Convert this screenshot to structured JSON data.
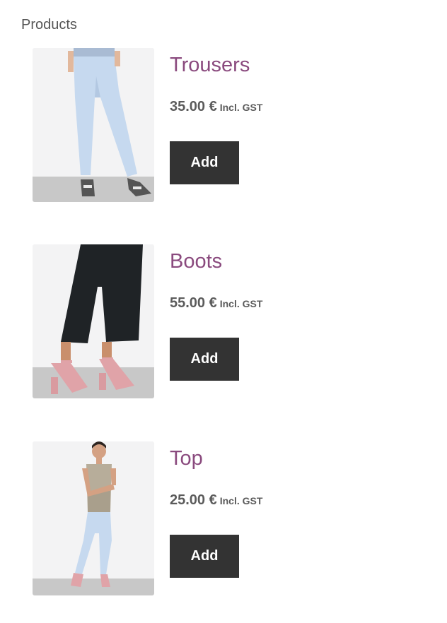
{
  "page": {
    "title": "Products"
  },
  "products": [
    {
      "name": "Trousers",
      "price": "35.00 €",
      "tax_label": "Incl. GST",
      "button_label": "Add"
    },
    {
      "name": "Boots",
      "price": "55.00 €",
      "tax_label": "Incl. GST",
      "button_label": "Add"
    },
    {
      "name": "Top",
      "price": "25.00 €",
      "tax_label": "Incl. GST",
      "button_label": "Add"
    }
  ],
  "colors": {
    "product_name": "#8a4a7e",
    "price": "#5b5b5b",
    "button_bg": "#333333",
    "button_text": "#ffffff"
  }
}
